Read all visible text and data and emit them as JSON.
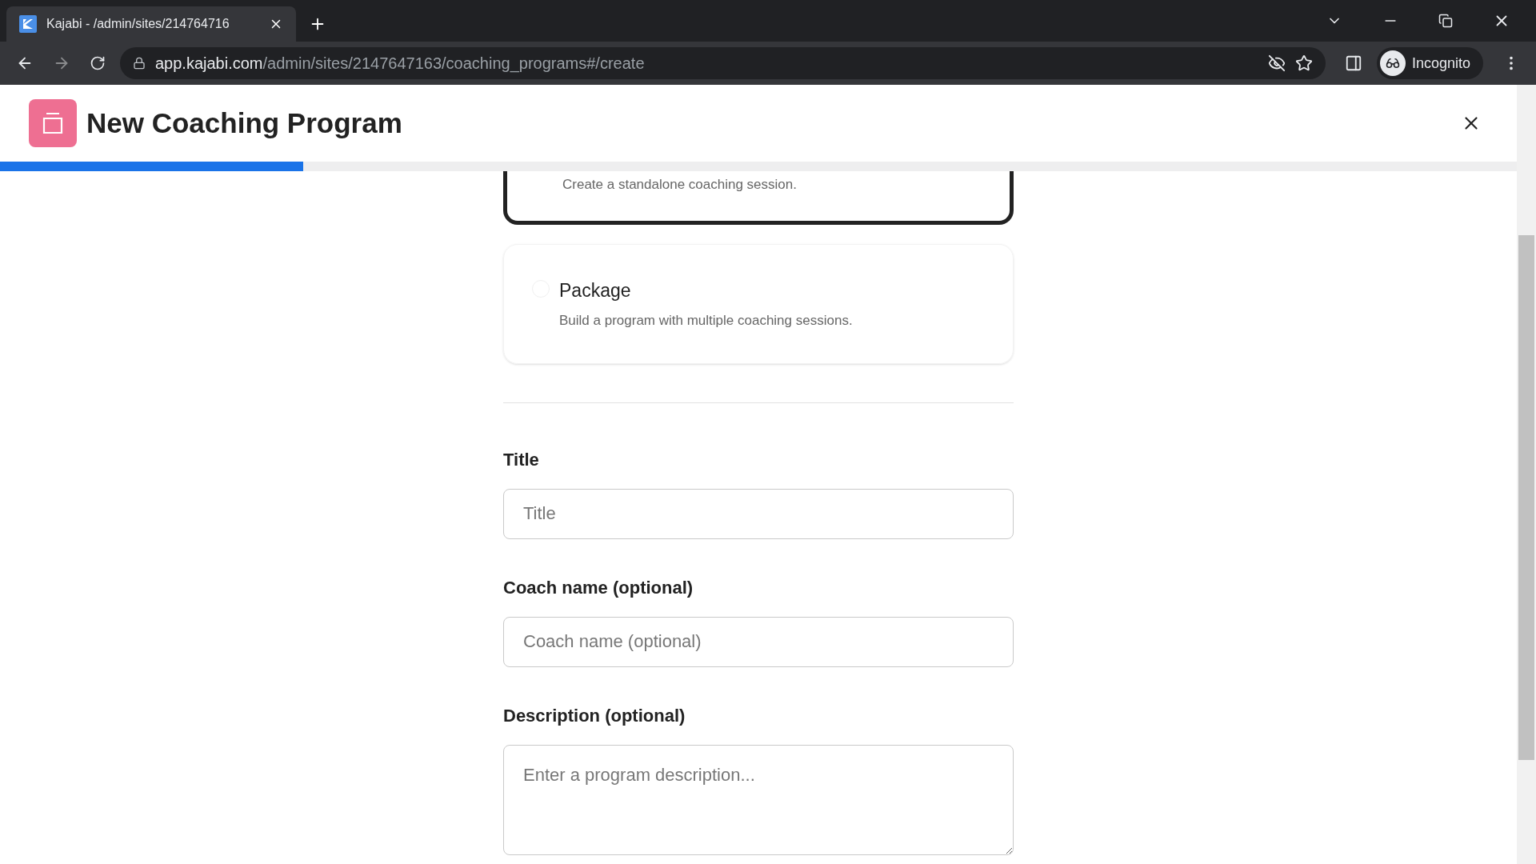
{
  "browser": {
    "tab_title": "Kajabi - /admin/sites/214764716",
    "url_host": "app.kajabi.com",
    "url_path": "/admin/sites/2147647163/coaching_programs#/create",
    "profile": "Incognito"
  },
  "header": {
    "title": "New Coaching Program",
    "progress": {
      "level": 0.2
    }
  },
  "options": [
    {
      "description": "Create a standalone coaching session.",
      "selected": true
    },
    {
      "title": "Package",
      "description": "Build a program with multiple coaching sessions.",
      "selected": false
    }
  ],
  "fields": [
    {
      "label": "Title",
      "placeholder": "Title",
      "kind": "input"
    },
    {
      "label": "Coach name (optional)",
      "placeholder": "Coach name (optional)",
      "kind": "input"
    },
    {
      "label": "Description (optional)",
      "placeholder": "Enter a program description...",
      "kind": "textarea"
    }
  ]
}
